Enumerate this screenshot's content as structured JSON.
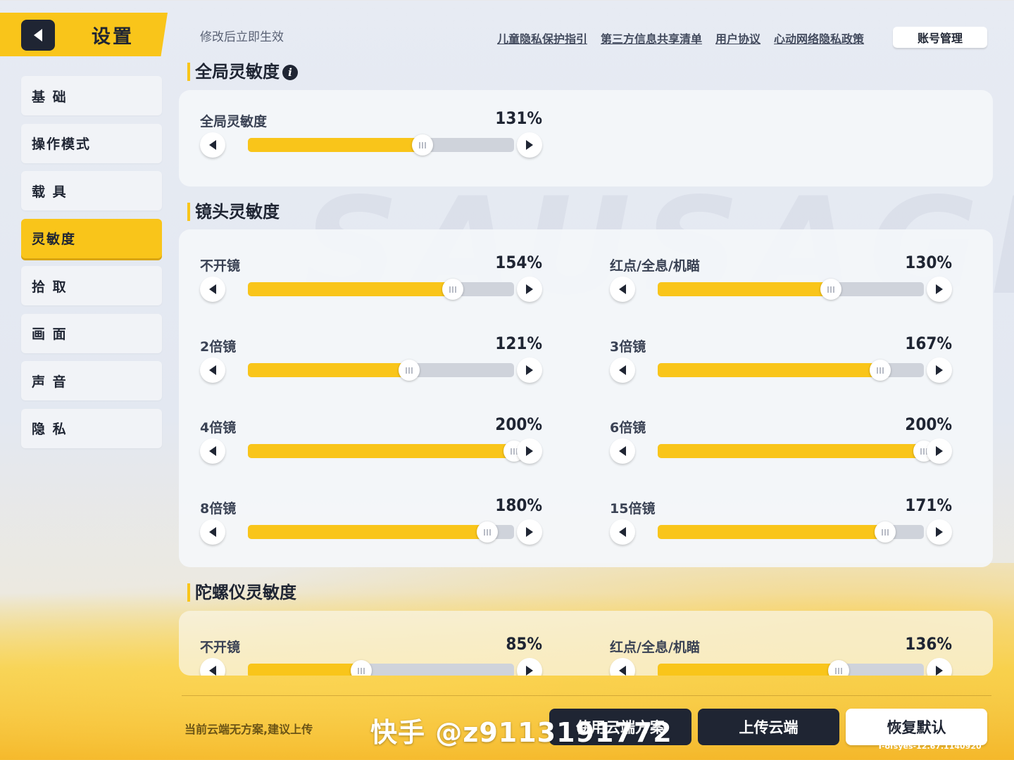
{
  "header": {
    "title": "设置",
    "hint": "修改后立即生效",
    "links": [
      "儿童隐私保护指引",
      "第三方信息共享清单",
      "用户协议",
      "心动网络隐私政策"
    ],
    "account_button": "账号管理"
  },
  "sidebar": {
    "items": [
      {
        "label": "基 础",
        "active": false
      },
      {
        "label": "操作模式",
        "active": false
      },
      {
        "label": "载 具",
        "active": false
      },
      {
        "label": "灵敏度",
        "active": true
      },
      {
        "label": "拾 取",
        "active": false
      },
      {
        "label": "画 面",
        "active": false
      },
      {
        "label": "声 音",
        "active": false
      },
      {
        "label": "隐 私",
        "active": false
      }
    ]
  },
  "sections": {
    "global": {
      "title": "全局灵敏度",
      "info_icon": "i",
      "sliders": [
        {
          "label": "全局灵敏度",
          "value": "131%",
          "level": 0.655
        }
      ]
    },
    "camera": {
      "title": "镜头灵敏度",
      "sliders": [
        {
          "label": "不开镜",
          "value": "154%",
          "level": 0.77
        },
        {
          "label": "红点/全息/机瞄",
          "value": "130%",
          "level": 0.65
        },
        {
          "label": "2倍镜",
          "value": "121%",
          "level": 0.605
        },
        {
          "label": "3倍镜",
          "value": "167%",
          "level": 0.835
        },
        {
          "label": "4倍镜",
          "value": "200%",
          "level": 1.0
        },
        {
          "label": "6倍镜",
          "value": "200%",
          "level": 1.0
        },
        {
          "label": "8倍镜",
          "value": "180%",
          "level": 0.9
        },
        {
          "label": "15倍镜",
          "value": "171%",
          "level": 0.855
        }
      ]
    },
    "gyro": {
      "title": "陀螺仪灵敏度",
      "sliders": [
        {
          "label": "不开镜",
          "value": "85%",
          "level": 0.425
        },
        {
          "label": "红点/全息/机瞄",
          "value": "136%",
          "level": 0.68
        }
      ]
    }
  },
  "footer": {
    "cloud_hint": "当前云端无方案,建议上传",
    "buttons": {
      "use_cloud": "使用云端方案",
      "upload": "上传云端",
      "reset": "恢复默认"
    },
    "version": "T-ofsyes-12.67.1140920"
  },
  "watermark": "快手 @z9113191772",
  "colors": {
    "accent": "#f9c51a",
    "dark": "#1f2533",
    "track": "#cfd3db"
  },
  "icons": [
    "back-arrow-icon",
    "info-icon",
    "arrow-left-icon",
    "arrow-right-icon",
    "slider-grip-icon"
  ]
}
